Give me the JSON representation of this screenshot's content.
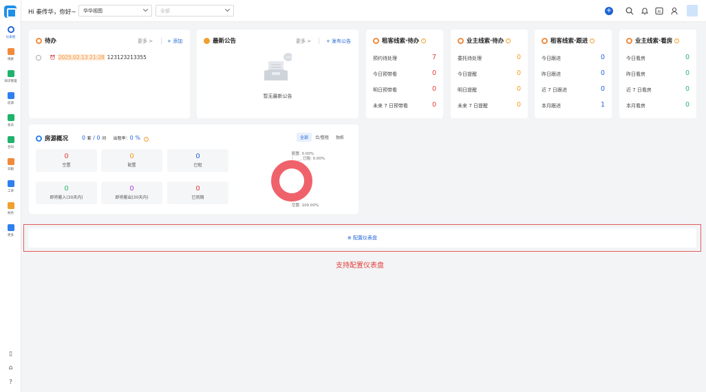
{
  "nav": [
    {
      "label": "仪表盘",
      "icon": "dashboard-icon",
      "color": "#1e63d6",
      "active": true
    },
    {
      "label": "线索",
      "icon": "leads-icon",
      "color": "#f08a3c"
    },
    {
      "label": "知识管理",
      "icon": "book-icon",
      "color": "#20b26b"
    },
    {
      "label": "房源",
      "icon": "building-icon",
      "color": "#2f80ed"
    },
    {
      "label": "会员",
      "icon": "member-icon",
      "color": "#20b26b"
    },
    {
      "label": "合同",
      "icon": "contract-icon",
      "color": "#20b26b"
    },
    {
      "label": "日租",
      "icon": "daily-rent-icon",
      "color": "#f08a3c"
    },
    {
      "label": "工单",
      "icon": "wrench-icon",
      "color": "#2f80ed"
    },
    {
      "label": "财务",
      "icon": "finance-icon",
      "color": "#f0a030"
    },
    {
      "label": "更多",
      "icon": "grid-icon",
      "color": "#2f80ed"
    }
  ],
  "topbar": {
    "greeting": "Hi 秦传华，你好~",
    "view_select": "华华视图",
    "scope_placeholder": "全部"
  },
  "todo": {
    "title": "待办",
    "more": "更多 >",
    "add": "+ 添加",
    "item_date": "2025.02.13 21:28",
    "item_text": "123123213355"
  },
  "notice": {
    "title": "最新公告",
    "more": "更多 >",
    "publish": "+ 发布公告",
    "empty": "暂无最新公告"
  },
  "stat_cards": [
    {
      "title": "租客线索·待办",
      "rows": [
        {
          "label": "预约待处理",
          "value": "7",
          "color": "red"
        },
        {
          "label": "今日预带看",
          "value": "0",
          "color": "red"
        },
        {
          "label": "明日预带看",
          "value": "0",
          "color": "red"
        },
        {
          "label": "未来 7 日预带看",
          "value": "0",
          "color": "red"
        }
      ]
    },
    {
      "title": "业主线索·待办",
      "rows": [
        {
          "label": "委托待处理",
          "value": "0",
          "color": "orange"
        },
        {
          "label": "今日提醒",
          "value": "0",
          "color": "orange"
        },
        {
          "label": "明日提醒",
          "value": "0",
          "color": "orange"
        },
        {
          "label": "未来 7 日提醒",
          "value": "0",
          "color": "orange"
        }
      ]
    },
    {
      "title": "租客线索·跟进",
      "rows": [
        {
          "label": "今日跟进",
          "value": "0",
          "color": "blue"
        },
        {
          "label": "昨日跟进",
          "value": "0",
          "color": "blue"
        },
        {
          "label": "近 7 日跟进",
          "value": "0",
          "color": "blue"
        },
        {
          "label": "本月跟进",
          "value": "1",
          "color": "blue"
        }
      ]
    },
    {
      "title": "业主线索·看房",
      "rows": [
        {
          "label": "今日看房",
          "value": "0",
          "color": "green"
        },
        {
          "label": "昨日看房",
          "value": "0",
          "color": "green"
        },
        {
          "label": "近 7 日看房",
          "value": "0",
          "color": "green"
        },
        {
          "label": "本月看房",
          "value": "0",
          "color": "green"
        }
      ]
    }
  ],
  "overview": {
    "title": "房源概况",
    "sets": "0",
    "sets_unit": "套",
    "slash": "/",
    "rooms": "0",
    "rooms_unit": "间",
    "rate_label": "出租率：",
    "rate_value": "0",
    "rate_unit": "%",
    "tabs": [
      "全部",
      "合/整租",
      "独栋"
    ],
    "tiles": [
      {
        "value": "0",
        "label": "空置",
        "color": "red"
      },
      {
        "value": "0",
        "label": "配置",
        "color": "orange"
      },
      {
        "value": "0",
        "label": "已租",
        "color": "blue"
      },
      {
        "value": "0",
        "label": "即将搬入(30天内)",
        "color": "green"
      },
      {
        "value": "0",
        "label": "即将搬出(30天内)",
        "color": "purple"
      },
      {
        "value": "0",
        "label": "已到期",
        "color": "red"
      }
    ]
  },
  "chart_data": {
    "type": "pie",
    "labels": [
      "配置",
      "已租",
      "空置"
    ],
    "values": [
      0,
      0,
      100
    ],
    "label_texts": [
      "配置: 0.00%",
      "已租: 0.00%",
      "空置: 100.00%"
    ],
    "colors": [
      "#f59a1a",
      "#1e63d6",
      "#f0626b"
    ]
  },
  "config": {
    "label": "配置仪表盘",
    "caption": "支持配置仪表盘"
  }
}
